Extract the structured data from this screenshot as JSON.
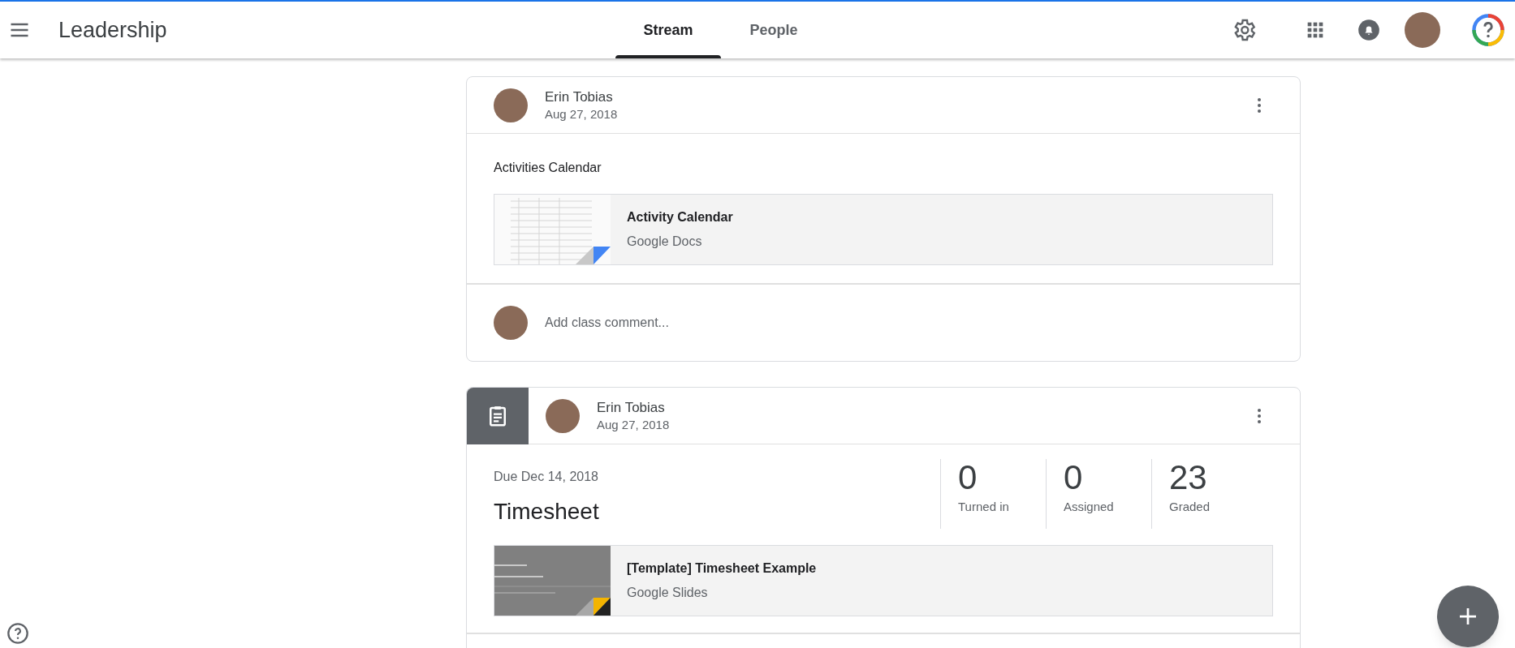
{
  "app_bar": {
    "title": "Leadership",
    "tabs": [
      {
        "label": "Stream",
        "selected": true
      },
      {
        "label": "People",
        "selected": false
      }
    ]
  },
  "posts": [
    {
      "kind": "material",
      "author": "Erin Tobias",
      "date": "Aug 27, 2018",
      "text": "Activities Calendar",
      "attachment": {
        "title": "Activity Calendar",
        "source": "Google Docs",
        "kind": "docs"
      },
      "comment_placeholder": "Add class comment..."
    },
    {
      "kind": "assignment",
      "author": "Erin Tobias",
      "date": "Aug 27, 2018",
      "due": "Due Dec 14, 2018",
      "title": "Timesheet",
      "stats": [
        {
          "value": "0",
          "label": "Turned in"
        },
        {
          "value": "0",
          "label": "Assigned"
        },
        {
          "value": "23",
          "label": "Graded"
        }
      ],
      "attachment": {
        "title": "[Template] Timesheet Example",
        "source": "Google Slides",
        "kind": "slides"
      }
    }
  ]
}
